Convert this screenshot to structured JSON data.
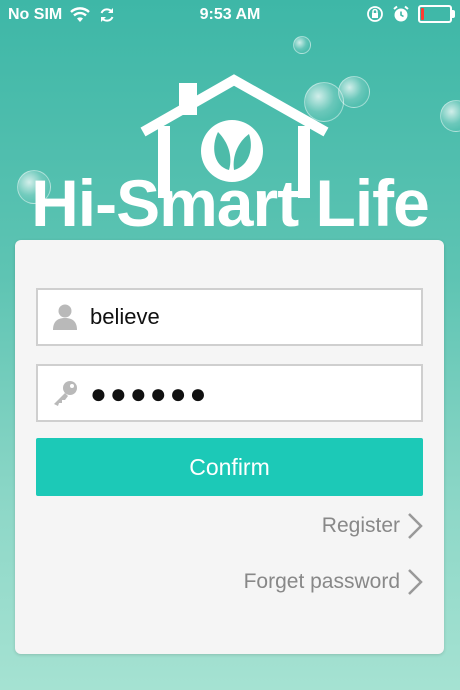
{
  "status_bar": {
    "carrier": "No SIM",
    "time": "9:53 AM",
    "battery_level": 0.12,
    "icons": [
      "wifi-icon",
      "sync-icon",
      "orientation-lock-icon",
      "alarm-icon",
      "battery-icon"
    ]
  },
  "logo": {
    "text": "Hi-Smart Life",
    "icons": [
      "house-icon",
      "leaf-icon"
    ]
  },
  "login": {
    "username_value": "believe",
    "password_masked": "●●●●●●",
    "confirm_label": "Confirm",
    "register_label": "Register",
    "forget_password_label": "Forget password"
  },
  "colors": {
    "background_top": "#3eb7a7",
    "background_bottom": "#a5e2d2",
    "accent": "#1cc9b7",
    "link_text": "#888888",
    "battery_low": "#ff3b30"
  }
}
